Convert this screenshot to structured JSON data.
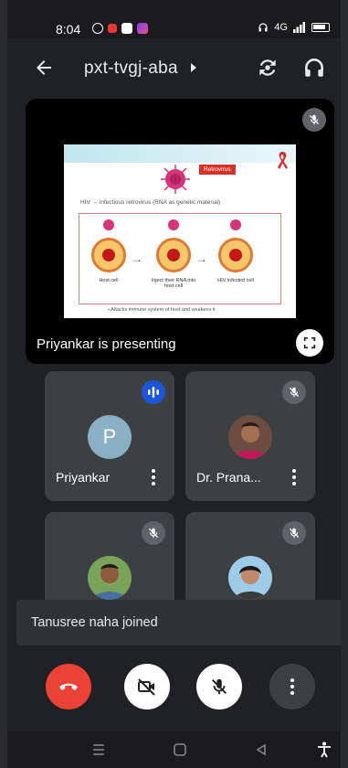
{
  "status_bar": {
    "time": "8:04",
    "signal_text": "4G"
  },
  "app_bar": {
    "meeting_code": "pxt-tvgj-aba"
  },
  "presentation": {
    "presenting_label": "Priyankar is presenting",
    "slide": {
      "tag": "Retrovirus",
      "caption": "HIV → infectious retrovirus (RNA as genetic material)",
      "steps": [
        "Host cell",
        "Inject their RNA into host cell",
        "HIV infected cell"
      ],
      "bullet": "• Attacks immune system of host and weakens it"
    }
  },
  "participants": [
    {
      "name": "Priyankar",
      "avatar_letter": "P",
      "status": "speaking"
    },
    {
      "name": "Dr. Prana...",
      "status": "muted"
    },
    {
      "name": "",
      "status": "muted"
    },
    {
      "name": "",
      "status": "muted"
    }
  ],
  "toast": {
    "message": "Tanusree naha joined"
  },
  "colors": {
    "end_call": "#ea4335",
    "speaking_badge": "#1a56db",
    "tile_bg": "#3c4043",
    "app_bg": "#202124"
  },
  "icons": {
    "back": "arrow-left-icon",
    "switch_camera": "switch-camera-icon",
    "audio": "headphones-icon",
    "fullscreen": "fullscreen-icon",
    "mic_off": "mic-off-icon",
    "camera_off": "camera-off-icon",
    "end_call": "phone-hangup-icon",
    "more": "more-vert-icon"
  }
}
